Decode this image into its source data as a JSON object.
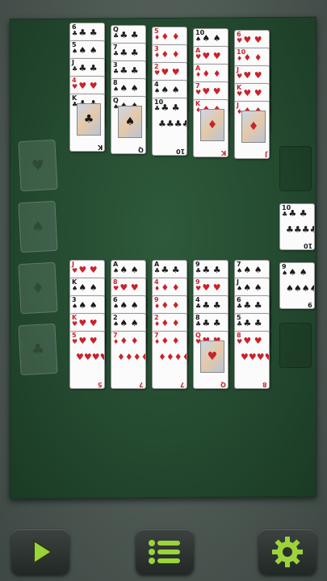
{
  "colors": {
    "felt": "#2a4f35",
    "accent": "#9bd43a",
    "red_suit": "#c8232c",
    "black_suit": "#1a1a1a"
  },
  "foundations": [
    {
      "suit": "♥",
      "color": "red"
    },
    {
      "suit": "♠",
      "color": "blk"
    },
    {
      "suit": "♦",
      "color": "red"
    },
    {
      "suit": "♣",
      "color": "blk"
    }
  ],
  "top_piles": [
    [
      {
        "r": "6",
        "s": "♣",
        "c": "blk"
      },
      {
        "r": "5",
        "s": "♠",
        "c": "blk"
      },
      {
        "r": "J",
        "s": "♣",
        "c": "blk"
      },
      {
        "r": "4",
        "s": "♥",
        "c": "red"
      },
      {
        "r": "K",
        "s": "♣",
        "c": "blk"
      }
    ],
    [
      {
        "r": "Q",
        "s": "♣",
        "c": "blk"
      },
      {
        "r": "7",
        "s": "♣",
        "c": "blk"
      },
      {
        "r": "3",
        "s": "♣",
        "c": "blk"
      },
      {
        "r": "8",
        "s": "♠",
        "c": "blk"
      },
      {
        "r": "Q",
        "s": "♠",
        "c": "blk"
      }
    ],
    [
      {
        "r": "5",
        "s": "♦",
        "c": "red"
      },
      {
        "r": "3",
        "s": "♦",
        "c": "red"
      },
      {
        "r": "2",
        "s": "♥",
        "c": "red"
      },
      {
        "r": "4",
        "s": "♠",
        "c": "blk"
      },
      {
        "r": "10",
        "s": "♣",
        "c": "blk"
      }
    ],
    [
      {
        "r": "10",
        "s": "♠",
        "c": "blk"
      },
      {
        "r": "A",
        "s": "♥",
        "c": "red"
      },
      {
        "r": "A",
        "s": "♦",
        "c": "red"
      },
      {
        "r": "7",
        "s": "♥",
        "c": "red"
      },
      {
        "r": "K",
        "s": "♦",
        "c": "red"
      }
    ],
    [
      {
        "r": "6",
        "s": "♥",
        "c": "red"
      },
      {
        "r": "10",
        "s": "♦",
        "c": "red"
      },
      {
        "r": "J",
        "s": "♥",
        "c": "red"
      },
      {
        "r": "K",
        "s": "♥",
        "c": "red"
      },
      {
        "r": "J",
        "s": "♦",
        "c": "red"
      }
    ]
  ],
  "bottom_piles": [
    [
      {
        "r": "J",
        "s": "♥",
        "c": "red"
      },
      {
        "r": "K",
        "s": "♠",
        "c": "blk"
      },
      {
        "r": "3",
        "s": "♠",
        "c": "blk"
      },
      {
        "r": "K",
        "s": "♥",
        "c": "red"
      },
      {
        "r": "5",
        "s": "♥",
        "c": "red"
      }
    ],
    [
      {
        "r": "A",
        "s": "♠",
        "c": "blk"
      },
      {
        "r": "8",
        "s": "♥",
        "c": "red"
      },
      {
        "r": "6",
        "s": "♠",
        "c": "blk"
      },
      {
        "r": "2",
        "s": "♠",
        "c": "blk"
      },
      {
        "r": "7",
        "s": "♦",
        "c": "red"
      }
    ],
    [
      {
        "r": "A",
        "s": "♣",
        "c": "blk"
      },
      {
        "r": "4",
        "s": "♦",
        "c": "red"
      },
      {
        "r": "9",
        "s": "♦",
        "c": "red"
      },
      {
        "r": "2",
        "s": "♦",
        "c": "red"
      },
      {
        "r": "7",
        "s": "♦",
        "c": "red"
      }
    ],
    [
      {
        "r": "9",
        "s": "♣",
        "c": "blk"
      },
      {
        "r": "9",
        "s": "♥",
        "c": "red"
      },
      {
        "r": "4",
        "s": "♣",
        "c": "blk"
      },
      {
        "r": "8",
        "s": "♣",
        "c": "blk"
      },
      {
        "r": "Q",
        "s": "♥",
        "c": "red"
      }
    ],
    [
      {
        "r": "7",
        "s": "♠",
        "c": "blk"
      },
      {
        "r": "J",
        "s": "♠",
        "c": "blk"
      },
      {
        "r": "6",
        "s": "♣",
        "c": "blk"
      },
      {
        "r": "5",
        "s": "♣",
        "c": "blk"
      },
      {
        "r": "8",
        "s": "♥",
        "c": "red"
      }
    ]
  ],
  "reserve": [
    {
      "r": "10",
      "s": "♣",
      "c": "blk"
    },
    {
      "r": "9",
      "s": "♠",
      "c": "blk"
    }
  ],
  "toolbar": [
    {
      "name": "play-button",
      "icon": "play-icon"
    },
    {
      "name": "menu-button",
      "icon": "menu-icon"
    },
    {
      "name": "settings-button",
      "icon": "gear-icon"
    }
  ]
}
